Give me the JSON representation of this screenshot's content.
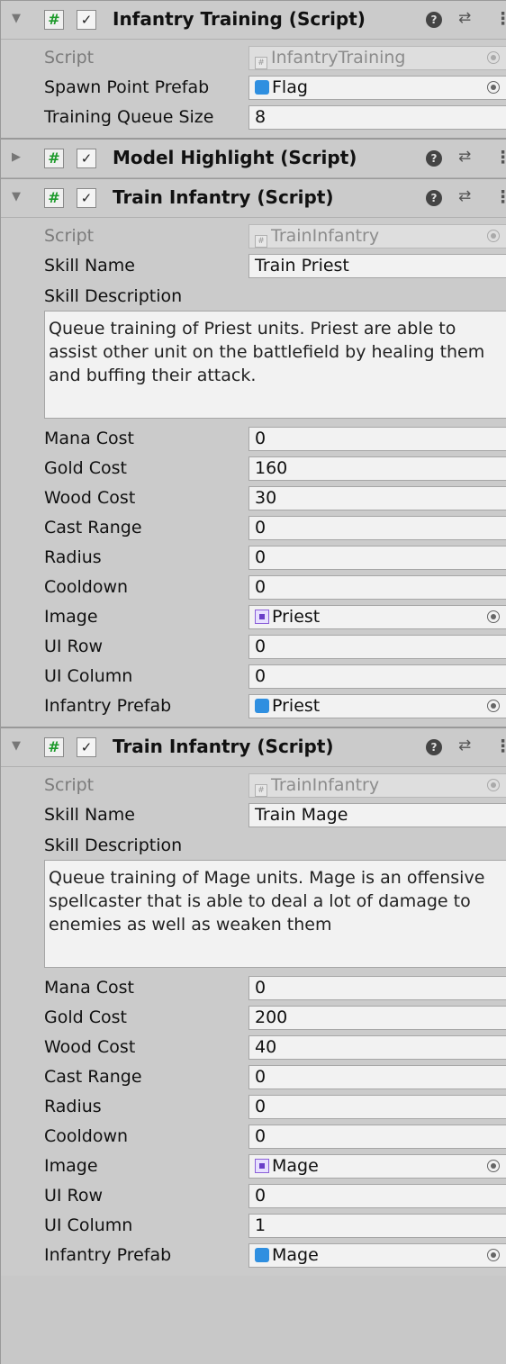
{
  "components": [
    {
      "title": "Infantry Training (Script)",
      "expanded": true,
      "rows": [
        {
          "label": "Script",
          "value": "InfantryTraining",
          "kind": "script",
          "disabled": true
        },
        {
          "label": "Spawn Point Prefab",
          "value": "Flag",
          "kind": "prefab"
        },
        {
          "label": "Training Queue Size",
          "value": "8",
          "kind": "text"
        }
      ]
    },
    {
      "title": "Model Highlight (Script)",
      "expanded": false
    },
    {
      "title": "Train Infantry (Script)",
      "expanded": true,
      "script": "TrainInfantry",
      "skill_name": "Train Priest",
      "skill_description": "Queue training of Priest units. Priest are able to assist other unit on the battlefield by healing them and buffing their attack.",
      "fields": [
        {
          "label": "Mana Cost",
          "value": "0"
        },
        {
          "label": "Gold Cost",
          "value": "160"
        },
        {
          "label": "Wood Cost",
          "value": "30"
        },
        {
          "label": "Cast Range",
          "value": "0"
        },
        {
          "label": "Radius",
          "value": "0"
        },
        {
          "label": "Cooldown",
          "value": "0"
        },
        {
          "label": "Image",
          "value": "Priest"
        },
        {
          "label": "UI Row",
          "value": "0"
        },
        {
          "label": "UI Column",
          "value": "0"
        },
        {
          "label": "Infantry Prefab",
          "value": "Priest"
        }
      ]
    },
    {
      "title": "Train Infantry (Script)",
      "expanded": true,
      "script": "TrainInfantry",
      "skill_name": "Train Mage",
      "skill_description": "Queue training of Mage units. Mage is an offensive spellcaster that is able to deal a lot of damage to enemies as well as weaken them",
      "fields": [
        {
          "label": "Mana Cost",
          "value": "0"
        },
        {
          "label": "Gold Cost",
          "value": "200"
        },
        {
          "label": "Wood Cost",
          "value": "40"
        },
        {
          "label": "Cast Range",
          "value": "0"
        },
        {
          "label": "Radius",
          "value": "0"
        },
        {
          "label": "Cooldown",
          "value": "0"
        },
        {
          "label": "Image",
          "value": "Mage"
        },
        {
          "label": "UI Row",
          "value": "0"
        },
        {
          "label": "UI Column",
          "value": "1"
        },
        {
          "label": "Infantry Prefab",
          "value": "Mage"
        }
      ]
    }
  ],
  "labels": {
    "script": "Script",
    "skill_name": "Skill Name",
    "skill_description": "Skill Description"
  },
  "icons": {
    "foldout_expanded": "▼",
    "foldout_collapsed": "▶",
    "script_glyph": "#",
    "check_glyph": "✓",
    "help_glyph": "?",
    "preset_glyph": "⇄",
    "menu_glyph": "⋮"
  },
  "colors": {
    "panel_bg": "#cbcbcb",
    "field_bg": "#f2f2f2",
    "script_icon_green": "#1c9a2a",
    "prefab_blue": "#2f8fe0",
    "sprite_purple": "#8b5fd8"
  }
}
